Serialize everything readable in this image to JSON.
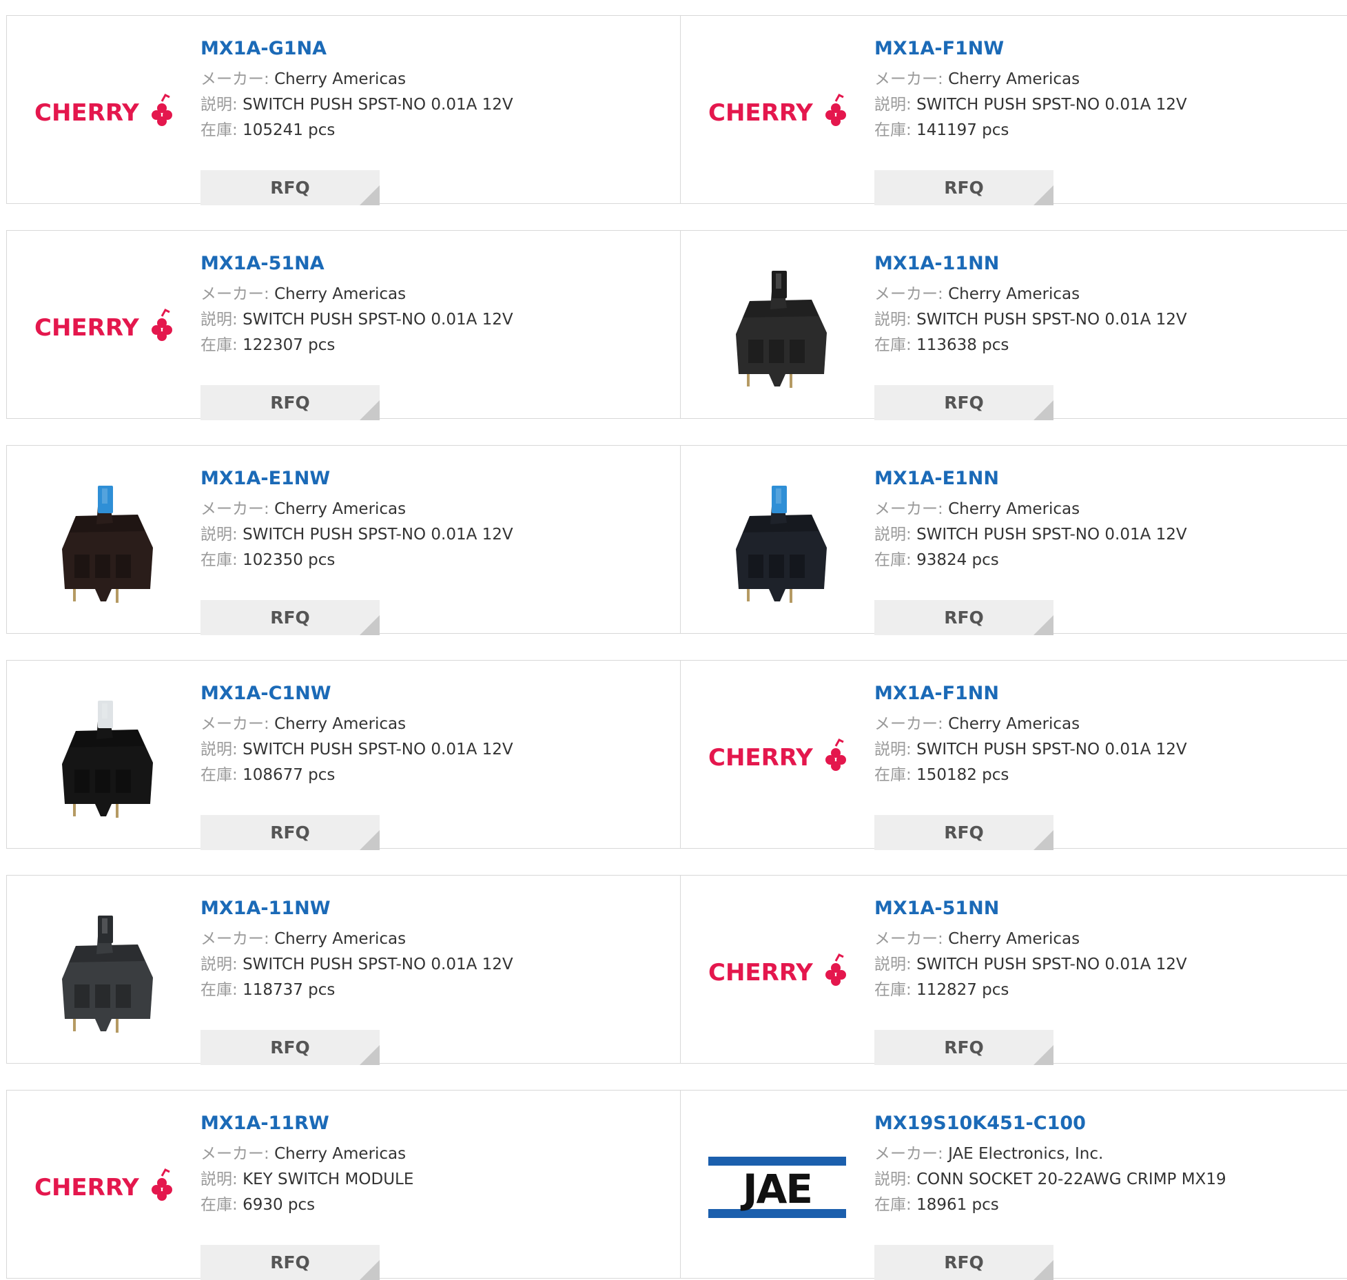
{
  "labels": {
    "maker": "メーカー:",
    "desc": "説明:",
    "stock": "在庫:"
  },
  "colors": {
    "part_link": "#1b6ab7",
    "button_bg": "#eeeeee",
    "border": "#d8d8d8",
    "label": "#9a9a9a"
  },
  "products": [
    {
      "part": "MX1A-G1NA",
      "maker": "Cherry Americas",
      "desc": "SWITCH PUSH SPST-NO 0.01A 12V",
      "stock": "105241 pcs",
      "button": "RFQ",
      "image": "cherry-logo",
      "logo_text": "CHERRY"
    },
    {
      "part": "MX1A-F1NW",
      "maker": "Cherry Americas",
      "desc": "SWITCH PUSH SPST-NO 0.01A 12V",
      "stock": "141197 pcs",
      "button": "RFQ",
      "image": "cherry-logo",
      "logo_text": "CHERRY"
    },
    {
      "part": "MX1A-51NA",
      "maker": "Cherry Americas",
      "desc": "SWITCH PUSH SPST-NO 0.01A 12V",
      "stock": "122307 pcs",
      "button": "RFQ",
      "image": "cherry-logo",
      "logo_text": "CHERRY"
    },
    {
      "part": "MX1A-11NN",
      "maker": "Cherry Americas",
      "desc": "SWITCH PUSH SPST-NO 0.01A 12V",
      "stock": "113638 pcs",
      "button": "RFQ",
      "image": "switch-black-stem",
      "stem_color": "#1c1c1c",
      "housing_color": "#2b2b2b"
    },
    {
      "part": "MX1A-E1NW",
      "maker": "Cherry Americas",
      "desc": "SWITCH PUSH SPST-NO 0.01A 12V",
      "stock": "102350 pcs",
      "button": "RFQ",
      "image": "switch-blue-stem",
      "stem_color": "#2f8fd6",
      "housing_color": "#2a1d1a"
    },
    {
      "part": "MX1A-E1NN",
      "maker": "Cherry Americas",
      "desc": "SWITCH PUSH SPST-NO 0.01A 12V",
      "stock": "93824 pcs",
      "button": "RFQ",
      "image": "switch-blue-stem",
      "stem_color": "#2f8fd6",
      "housing_color": "#1e222a"
    },
    {
      "part": "MX1A-C1NW",
      "maker": "Cherry Americas",
      "desc": "SWITCH PUSH SPST-NO 0.01A 12V",
      "stock": "108677 pcs",
      "button": "RFQ",
      "image": "switch-clear-stem",
      "stem_color": "#dfe3e6",
      "housing_color": "#151515"
    },
    {
      "part": "MX1A-F1NN",
      "maker": "Cherry Americas",
      "desc": "SWITCH PUSH SPST-NO 0.01A 12V",
      "stock": "150182 pcs",
      "button": "RFQ",
      "image": "cherry-logo",
      "logo_text": "CHERRY"
    },
    {
      "part": "MX1A-11NW",
      "maker": "Cherry Americas",
      "desc": "SWITCH PUSH SPST-NO 0.01A 12V",
      "stock": "118737 pcs",
      "button": "RFQ",
      "image": "switch-black-stem",
      "stem_color": "#2a2d30",
      "housing_color": "#3a3d40"
    },
    {
      "part": "MX1A-51NN",
      "maker": "Cherry Americas",
      "desc": "SWITCH PUSH SPST-NO 0.01A 12V",
      "stock": "112827 pcs",
      "button": "RFQ",
      "image": "cherry-logo",
      "logo_text": "CHERRY"
    },
    {
      "part": "MX1A-11RW",
      "maker": "Cherry Americas",
      "desc": "KEY SWITCH MODULE",
      "stock": "6930 pcs",
      "button": "RFQ",
      "image": "cherry-logo",
      "logo_text": "CHERRY"
    },
    {
      "part": "MX19S10K451-C100",
      "maker": "JAE Electronics, Inc.",
      "desc": "CONN SOCKET 20-22AWG CRIMP MX19",
      "stock": "18961 pcs",
      "button": "RFQ",
      "image": "jae-logo",
      "logo_text": "JAE"
    }
  ]
}
